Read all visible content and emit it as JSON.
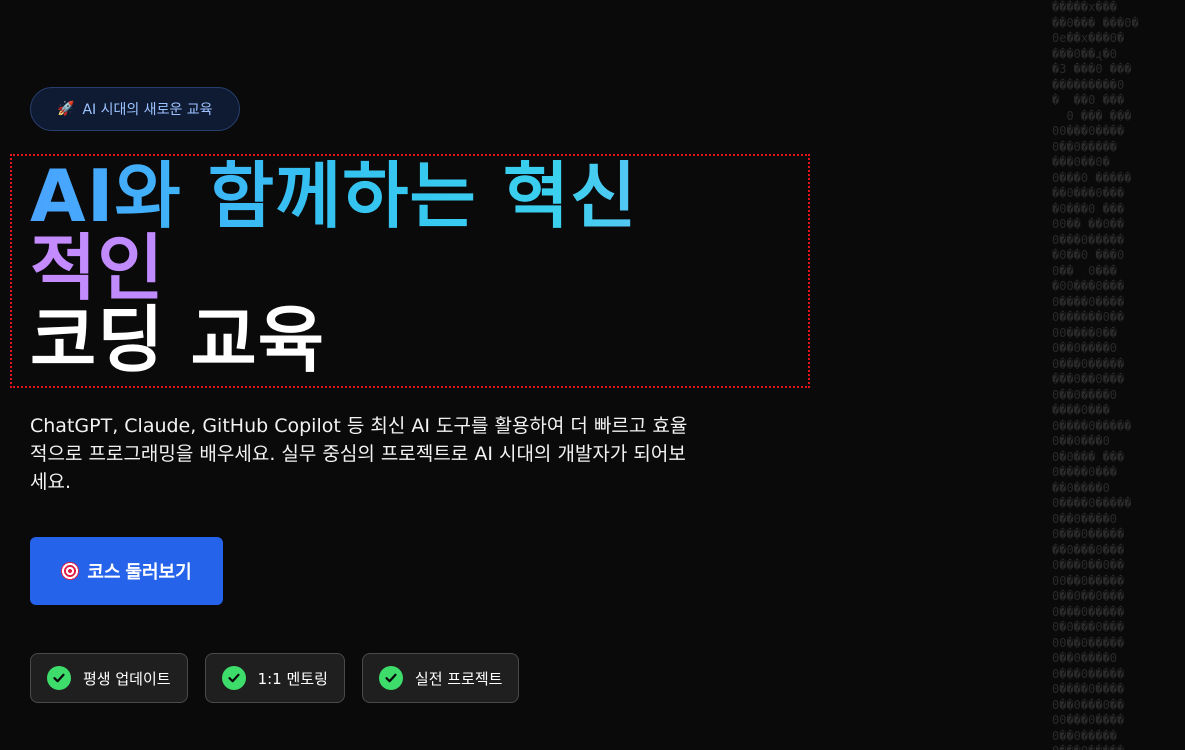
{
  "badge": {
    "emoji": "🚀",
    "text": "AI 시대의 새로운 교육"
  },
  "headline": {
    "line1_part1": "AI와 함께하는 혁신",
    "line2": "적인",
    "line3": "코딩 교육"
  },
  "description": "ChatGPT, Claude, GitHub Copilot 등 최신 AI 도구를 활용하여 더 빠르고 효율적으로 프로그래밍을 배우세요. 실무 중심의 프로젝트로 AI 시대의 개발자가 되어보세요.",
  "cta": {
    "label": "코스 둘러보기",
    "icon": "target-icon"
  },
  "features": [
    {
      "label": "평생 업데이트",
      "icon": "check-icon"
    },
    {
      "label": "1:1 멘토링",
      "icon": "check-icon"
    },
    {
      "label": "실전 프로젝트",
      "icon": "check-icon"
    }
  ],
  "colors": {
    "background": "#0a0a0a",
    "accent_blue": "#2563eb",
    "check_green": "#3ddc6b",
    "gradient_start": "#4aa3ff",
    "gradient_purple": "#c48bff",
    "highlight_outline": "#e0141a"
  }
}
